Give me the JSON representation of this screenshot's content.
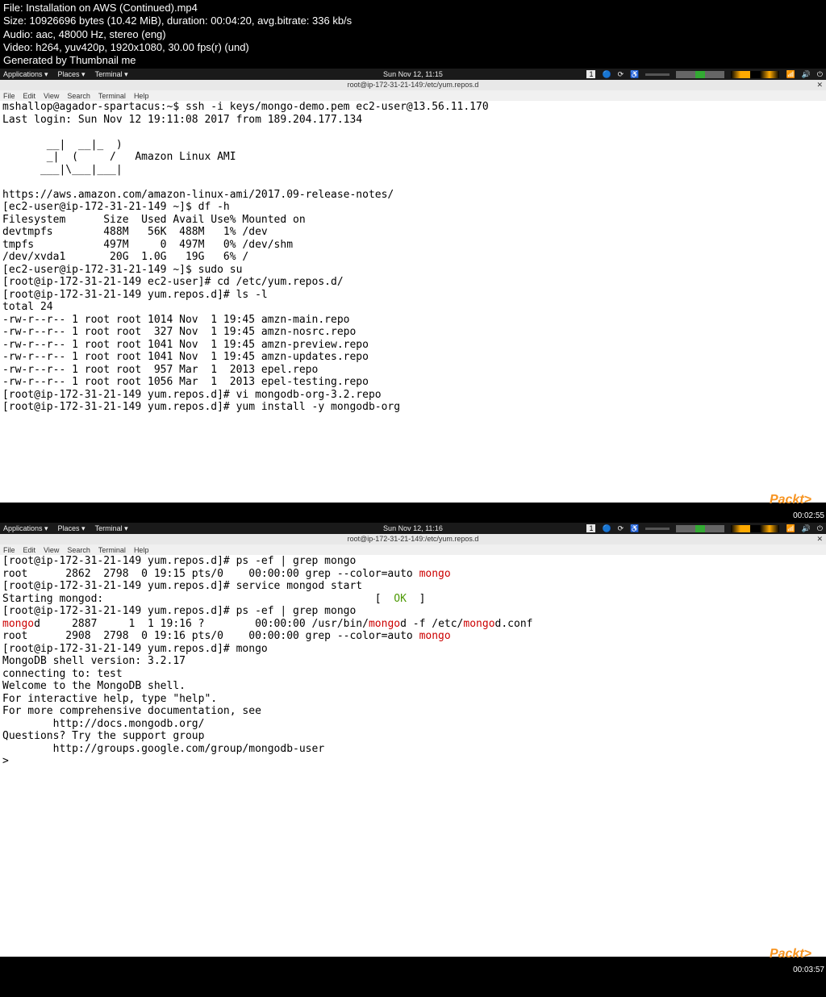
{
  "fileinfo": {
    "line1": "File: Installation on AWS (Continued).mp4",
    "line2": "Size: 10926696 bytes (10.42 MiB), duration: 00:04:20, avg.bitrate: 336 kb/s",
    "line3": "Audio: aac, 48000 Hz, stereo (eng)",
    "line4": "Video: h264, yuv420p, 1920x1080, 30.00 fps(r) (und)",
    "line5": "Generated by Thumbnail me"
  },
  "gnome": {
    "apps": "Applications ▾",
    "places": "Places ▾",
    "term": "Terminal ▾",
    "time1": "Sun Nov 12, 11:15",
    "time2": "Sun Nov 12, 11:16",
    "ws": "1"
  },
  "titlebar": {
    "title": "root@ip-172-31-21-149:/etc/yum.repos.d"
  },
  "menus": {
    "file": "File",
    "edit": "Edit",
    "view": "View",
    "search": "Search",
    "terminal": "Terminal",
    "help": "Help"
  },
  "shot1": {
    "l1": "mshallop@agador-spartacus:~$ ssh -i keys/mongo-demo.pem ec2-user@13.56.11.170",
    "l2": "Last login: Sun Nov 12 19:11:08 2017 from 189.204.177.134",
    "l3": "",
    "l4": "       __|  __|_  )",
    "l5": "       _|  (     /   Amazon Linux AMI",
    "l6": "      ___|\\___|___|",
    "l7": "",
    "l8": "https://aws.amazon.com/amazon-linux-ami/2017.09-release-notes/",
    "l9": "[ec2-user@ip-172-31-21-149 ~]$ df -h",
    "l10": "Filesystem      Size  Used Avail Use% Mounted on",
    "l11": "devtmpfs        488M   56K  488M   1% /dev",
    "l12": "tmpfs           497M     0  497M   0% /dev/shm",
    "l13": "/dev/xvda1       20G  1.0G   19G   6% /",
    "l14": "[ec2-user@ip-172-31-21-149 ~]$ sudo su",
    "l15": "[root@ip-172-31-21-149 ec2-user]# cd /etc/yum.repos.d/",
    "l16": "[root@ip-172-31-21-149 yum.repos.d]# ls -l",
    "l17": "total 24",
    "l18": "-rw-r--r-- 1 root root 1014 Nov  1 19:45 amzn-main.repo",
    "l19": "-rw-r--r-- 1 root root  327 Nov  1 19:45 amzn-nosrc.repo",
    "l20": "-rw-r--r-- 1 root root 1041 Nov  1 19:45 amzn-preview.repo",
    "l21": "-rw-r--r-- 1 root root 1041 Nov  1 19:45 amzn-updates.repo",
    "l22": "-rw-r--r-- 1 root root  957 Mar  1  2013 epel.repo",
    "l23": "-rw-r--r-- 1 root root 1056 Mar  1  2013 epel-testing.repo",
    "l24": "[root@ip-172-31-21-149 yum.repos.d]# vi mongodb-org-3.2.repo",
    "l25": "[root@ip-172-31-21-149 yum.repos.d]# yum install -y mongodb-org"
  },
  "shot2": {
    "l1": "[root@ip-172-31-21-149 yum.repos.d]# ps -ef | grep mongo",
    "l2a": "root      2862  2798  0 19:15 pts/0    00:00:00 grep --color=auto ",
    "l2b": "mongo",
    "l3": "[root@ip-172-31-21-149 yum.repos.d]# service mongod start",
    "l4a": "Starting mongod:                                           [  ",
    "l4b": "OK",
    "l4c": "  ]",
    "l5": "[root@ip-172-31-21-149 yum.repos.d]# ps -ef | grep mongo",
    "l6a": "mongo",
    "l6b": "d     2887     1  1 19:16 ?        00:00:00 /usr/bin/",
    "l6c": "mongo",
    "l6d": "d -f /etc/",
    "l6e": "mongo",
    "l6f": "d.conf",
    "l7a": "root      2908  2798  0 19:16 pts/0    00:00:00 grep --color=auto ",
    "l7b": "mongo",
    "l8": "[root@ip-172-31-21-149 yum.repos.d]# mongo",
    "l9": "MongoDB shell version: 3.2.17",
    "l10": "connecting to: test",
    "l11": "Welcome to the MongoDB shell.",
    "l12": "For interactive help, type \"help\".",
    "l13": "For more comprehensive documentation, see",
    "l14": "        http://docs.mongodb.org/",
    "l15": "Questions? Try the support group",
    "l16": "        http://groups.google.com/group/mongodb-user",
    "l17": "> "
  },
  "packt": "Packt>",
  "ts1": "00:02:55",
  "ts2": "00:03:57"
}
